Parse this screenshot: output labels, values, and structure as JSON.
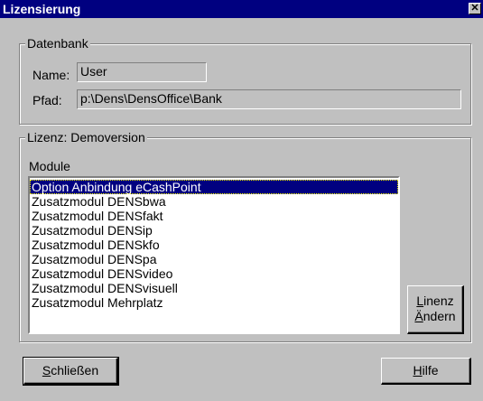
{
  "window": {
    "title": "Lizensierung",
    "close_glyph": "✕"
  },
  "datenbank": {
    "legend": "Datenbank",
    "name_label": "Name:",
    "name_value": "User",
    "pfad_label": "Pfad:",
    "pfad_value": "p:\\Dens\\DensOffice\\Bank"
  },
  "lizenz": {
    "legend": "Lizenz: Demoversion",
    "module_label": "Module",
    "modules": [
      "Option Anbindung eCashPoint",
      "Zusatzmodul DENSbwa",
      "Zusatzmodul DENSfakt",
      "Zusatzmodul DENSip",
      "Zusatzmodul DENSkfo",
      "Zusatzmodul DENSpa",
      "Zusatzmodul DENSvideo",
      "Zusatzmodul DENSvisuell",
      "Zusatzmodul Mehrplatz"
    ],
    "selected_index": 0,
    "change_button": {
      "line1_first": "L",
      "line1_rest": "inenz",
      "line2_first": "Ä",
      "line2_rest": "ndern"
    }
  },
  "footer": {
    "close_button": {
      "first": "S",
      "rest": "chließen"
    },
    "help_button": {
      "first": "H",
      "rest": "ilfe"
    }
  }
}
